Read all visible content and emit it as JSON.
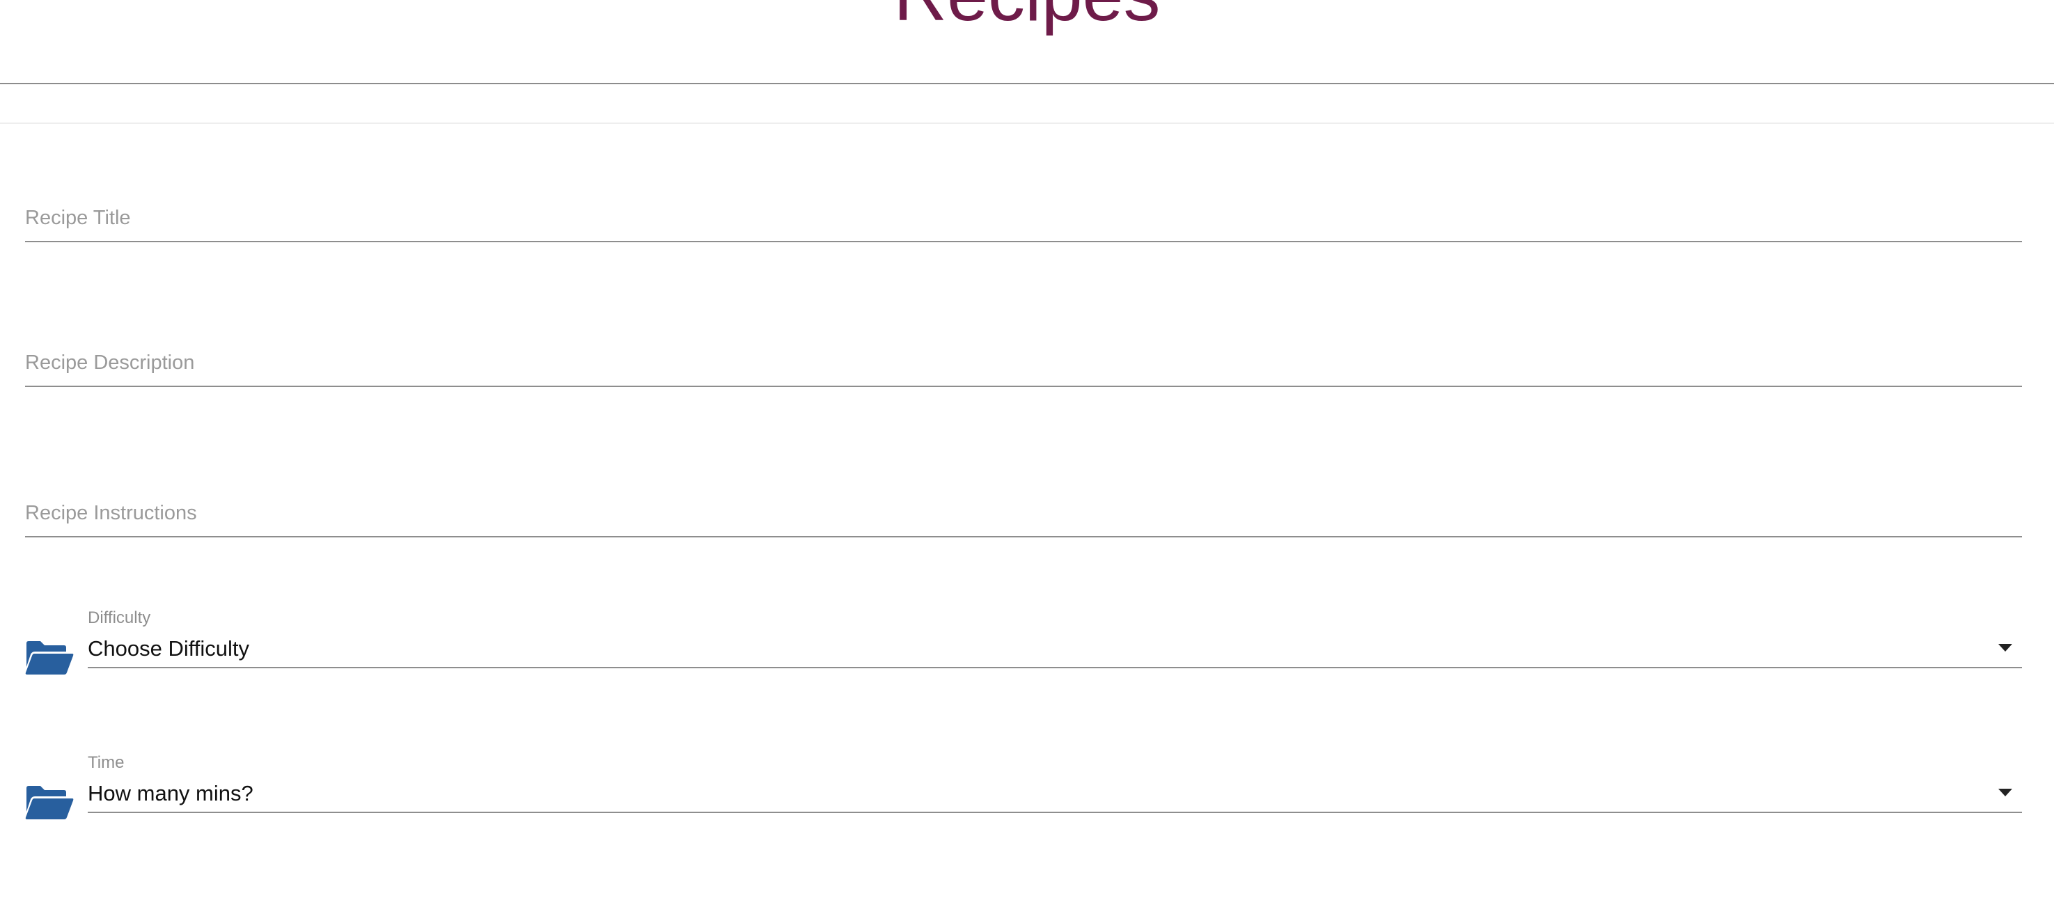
{
  "header": {
    "title": "Recipes"
  },
  "form": {
    "title_field": {
      "placeholder": "Recipe Title",
      "value": ""
    },
    "description_field": {
      "placeholder": "Recipe Description",
      "value": ""
    },
    "instructions_field": {
      "placeholder": "Recipe Instructions",
      "value": ""
    },
    "difficulty": {
      "label": "Difficulty",
      "selected": "Choose Difficulty",
      "icon": "folder-open-icon"
    },
    "time": {
      "label": "Time",
      "selected": "How many mins?",
      "icon": "folder-open-icon"
    }
  },
  "colors": {
    "title": "#6e1b49",
    "icon": "#285f9e",
    "underline": "#8e8e8e",
    "placeholder": "#9a9a9a"
  }
}
